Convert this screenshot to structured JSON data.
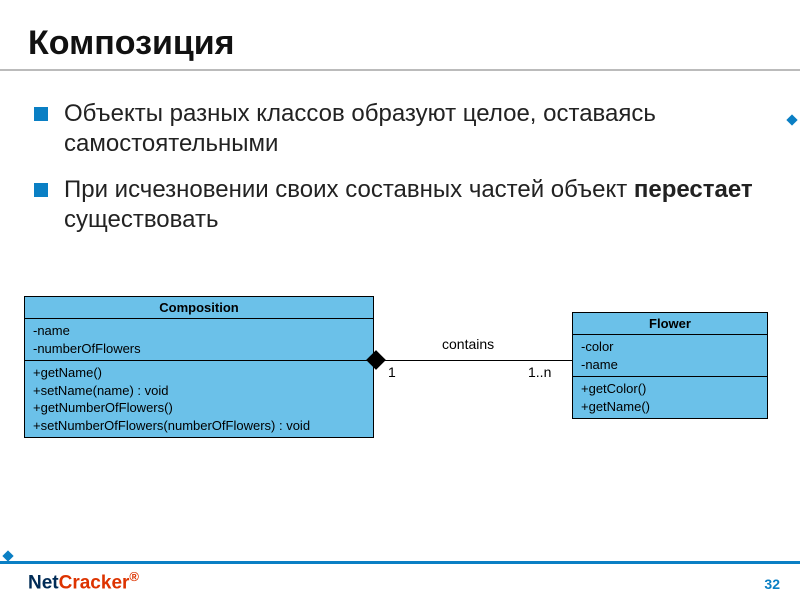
{
  "title": "Композиция",
  "bullets": [
    {
      "pre": "Объекты разных классов образуют целое, оставаясь самостоятельными",
      "bold": "",
      "post": ""
    },
    {
      "pre": "При исчезновении своих составных частей объект ",
      "bold": "перестает",
      "post": " существовать"
    }
  ],
  "uml": {
    "left": {
      "name": "Composition",
      "attributes": [
        "-name",
        "-numberOfFlowers"
      ],
      "operations": [
        "+getName()",
        "+setName(name) : void",
        "+getNumberOfFlowers()",
        "+setNumberOfFlowers(numberOfFlowers) : void"
      ]
    },
    "right": {
      "name": "Flower",
      "attributes": [
        "-color",
        "-name"
      ],
      "operations": [
        "+getColor()",
        "+getName()"
      ]
    },
    "association": {
      "label": "contains",
      "leftMultiplicity": "1",
      "rightMultiplicity": "1..n"
    }
  },
  "footer": {
    "logo_pre": "Net",
    "logo_post": "Cracker",
    "page": "32"
  }
}
